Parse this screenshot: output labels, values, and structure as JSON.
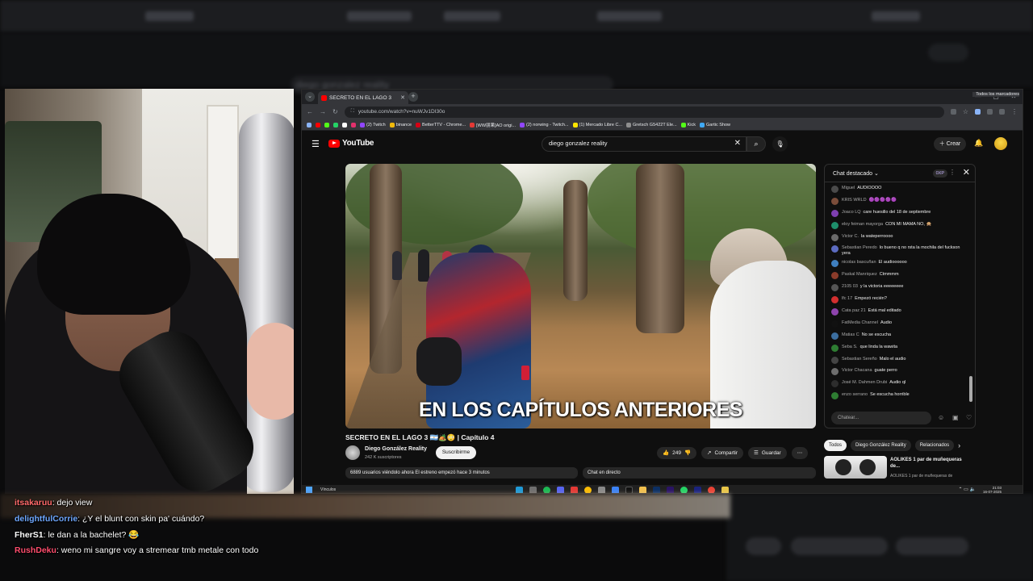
{
  "background": {
    "search_text": "diego gonzalez reality",
    "create_label": "Crear",
    "bottom_chip_1": "Todos",
    "bottom_chip_2": "Diego González Reality",
    "bottom_chip_3": "Relacionados"
  },
  "browser": {
    "tab_title": "SECRETO EN EL LAGO 3",
    "url": "youtube.com/watch?v=nuWJv1DI30o",
    "bookmarks": [
      {
        "label": "(2) Twitch",
        "color": "#9146ff"
      },
      {
        "label": "binance",
        "color": "#f0b90b"
      },
      {
        "label": "BetterTTV - Chrome...",
        "color": "#d50014"
      },
      {
        "label": "[WW朋果]AO origi...",
        "color": "#e53935"
      },
      {
        "label": "(2) norwing - Twitch...",
        "color": "#9146ff"
      },
      {
        "label": "(1) Mercado Libre C...",
        "color": "#ffe600"
      },
      {
        "label": "Gretsch G5422T Ele...",
        "color": "#8e8e8e"
      },
      {
        "label": "Kick",
        "color": "#53fc18"
      },
      {
        "label": "Gartic Show",
        "color": "#3fa9f5"
      }
    ],
    "all_bookmarks": "Todos los marcadores"
  },
  "youtube": {
    "logo": "YouTube",
    "search_value": "diego gonzalez reality",
    "create_label": "Crear",
    "video": {
      "caption": "EN LOS CAPÍTULOS ANTERIORES",
      "title": "SECRETO EN EL LAGO 3 🇦🇷🏕️😳 | Capítulo 4",
      "channel": "Diego González Reality",
      "subscribers": "242 K suscriptores",
      "subscribe_label": "Suscribirme",
      "likes": "249",
      "share_label": "Compartir",
      "save_label": "Guardar",
      "viewers": "6889 usuarios viéndolo ahora  El estreno empezó hace 3 minutos",
      "live_chat": "Chat en directo"
    },
    "chat": {
      "title": "Chat destacado",
      "xp": "0XP",
      "input_placeholder": "Chatear...",
      "messages": [
        {
          "author": "Miguel",
          "text": "AUDIOOOO",
          "color": "#4a4a4a"
        },
        {
          "author": "KRIS WRLD",
          "text": "🟣🟣🟣🟣🟣",
          "color": "#7b4d3a"
        },
        {
          "author": "Joaco LQ",
          "text": "care huesillo del 18 de septiembre",
          "color": "#7e3fb0"
        },
        {
          "author": "eloy feiman mayorga",
          "text": "CON MI MAMA NO, 🙊",
          "color": "#1e8e6b"
        },
        {
          "author": "Victor C.",
          "text": "la wateperroooo",
          "color": "#6a6a6a"
        },
        {
          "author": "Sebastian Peredo",
          "text": "lo bueno q no rsta la mochila del fuckson yera",
          "color": "#5c6bc0"
        },
        {
          "author": "nicolas bascuñan",
          "text": "El audioooooo",
          "color": "#3f7fbf"
        },
        {
          "author": "Paskal Manriquez",
          "text": "Ctmmmm",
          "color": "#8a3b2a"
        },
        {
          "author": "2105 03",
          "text": "y la victoria eeeeeeee",
          "color": "#555555"
        },
        {
          "author": "lfc 17",
          "text": "Empezó recién?",
          "color": "#d32f2f"
        },
        {
          "author": "Cata paz 21",
          "text": "Está mal editado",
          "color": "#8e44ad"
        },
        {
          "author": "FatMedia Channel",
          "text": "Audio",
          "color": "#111111"
        },
        {
          "author": "Matias C",
          "text": "No se escucha",
          "color": "#3c6e9f"
        },
        {
          "author": "Seba S.",
          "text": "que linda la wawita",
          "color": "#2e7d32"
        },
        {
          "author": "Sebastian Sereño",
          "text": "Malo el audio",
          "color": "#444444"
        },
        {
          "author": "Victor Chacana",
          "text": "guate perro",
          "color": "#6d6d6d"
        },
        {
          "author": "José M. Dahmen Drubi",
          "text": "Audio ql",
          "color": "#2d2d2d"
        },
        {
          "author": "enzo serrano",
          "text": "Se escucha horrible",
          "color": "#2e7d32"
        }
      ]
    },
    "chips": [
      "Todos",
      "Diego González Reality",
      "Relacionados"
    ],
    "recommendation": {
      "title": "AOLIKES 1 par de muñequeras de...",
      "subtitle": "AOLIKES 1 par de muñequeras de"
    }
  },
  "taskbar": {
    "label": "Vínculos",
    "time": "21:03",
    "date": "16-07-2025"
  },
  "stream_chat": [
    {
      "user": "itsakaruu",
      "message": ": dejo view",
      "color": "#ff6a6a"
    },
    {
      "user": "delightfulCorrie",
      "message": ": ¿Y el blunt con skin pa' cuándo?",
      "color": "#6fa8ff"
    },
    {
      "user": "FherS1",
      "message": ": le dan a la bachelet? 😂",
      "color": "#ffffff"
    },
    {
      "user": "RushDeku",
      "message": ": weno mi sangre voy a stremear tmb metale con todo",
      "color": "#ff4d6d"
    }
  ]
}
